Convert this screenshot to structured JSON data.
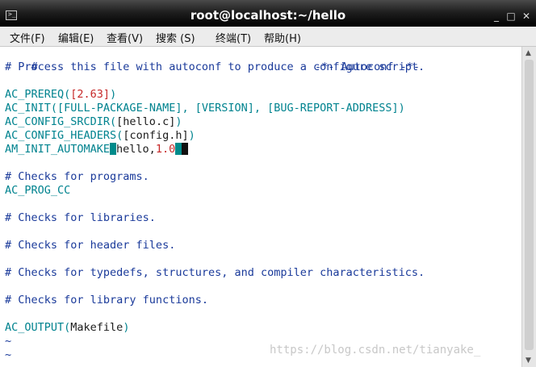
{
  "window": {
    "title": "root@localhost:~/hello",
    "icon": "terminal-icon",
    "controls": [
      "minimize",
      "maximize",
      "close"
    ]
  },
  "menu": [
    "文件(F)",
    "编辑(E)",
    "查看(V)",
    "搜索 (S)",
    "终端(T)",
    "帮助(H)"
  ],
  "editor": {
    "lines": {
      "l1a": "#",
      "l1b": "-*- Autoconf -*-",
      "l2": "# Process this file with autoconf to produce a configure script.",
      "l4a": "AC_PREREQ(",
      "l4b": "[2.63]",
      "l4c": ")",
      "l5a": "AC_INIT(",
      "l5b": "[FULL-PACKAGE-NAME], [VERSION], [BUG-REPORT-ADDRESS]",
      "l5c": ")",
      "l6a": "AC_CONFIG_SRCDIR(",
      "l6b": "[hello.c]",
      "l6c": ")",
      "l7a": "AC_CONFIG_HEADERS(",
      "l7b": "[config.h]",
      "l7c": ")",
      "l8a": "AM_INIT_AUTOMAKE",
      "l8b": "hello,",
      "l8c": "1.0",
      "l10": "# Checks for programs.",
      "l11": "AC_PROG_CC",
      "l13": "# Checks for libraries.",
      "l15": "# Checks for header files.",
      "l17": "# Checks for typedefs, structures, and compiler characteristics.",
      "l19": "# Checks for library functions.",
      "l21a": "AC_OUTPUT(",
      "l21b": "Makefile",
      "l21c": ")",
      "tilde1": "~",
      "tilde2": "~"
    }
  },
  "watermark": "https://blog.csdn.net/tianyake_",
  "colors": {
    "comment": "#1a3a9a",
    "keyword": "#00838f",
    "string": "#c62828",
    "cursor": "#008b8b"
  }
}
